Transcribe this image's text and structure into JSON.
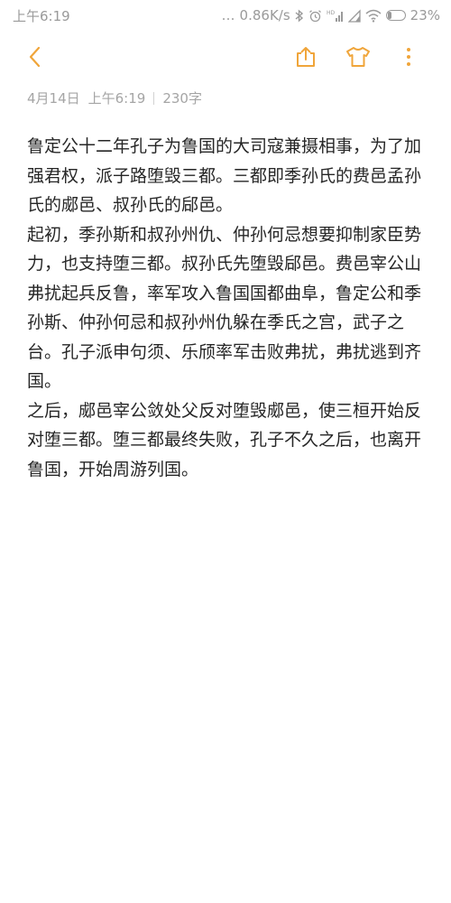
{
  "status_bar": {
    "time": "上午6:19",
    "dots": "…",
    "speed": "0.86K/s",
    "battery": "23%",
    "battery_level": 0.23
  },
  "toolbar": {
    "accent_color": "#f0a53a",
    "icons": [
      "back-icon",
      "share-icon",
      "theme-icon",
      "more-icon"
    ]
  },
  "meta": {
    "date": "4月14日",
    "time": "上午6:19",
    "word_count": "230字"
  },
  "note": {
    "paragraphs": [
      "鲁定公十二年孔子为鲁国的大司寇兼摄相事，为了加强君权，派子路堕毁三都。三都即季孙氏的费邑孟孙氏的郕邑、叔孙氏的郈邑。",
      "起初，季孙斯和叔孙州仇、仲孙何忌想要抑制家臣势力，也支持堕三都。叔孙氏先堕毁郈邑。费邑宰公山弗扰起兵反鲁，率军攻入鲁国国都曲阜，鲁定公和季孙斯、仲孙何忌和叔孙州仇躲在季氏之宫，武子之台。孔子派申句须、乐颀率军击败弗扰，弗扰逃到齐国。",
      "之后，郕邑宰公敛处父反对堕毁郕邑，使三桓开始反对堕三都。堕三都最终失败，孔子不久之后，也离开鲁国，开始周游列国。"
    ]
  }
}
